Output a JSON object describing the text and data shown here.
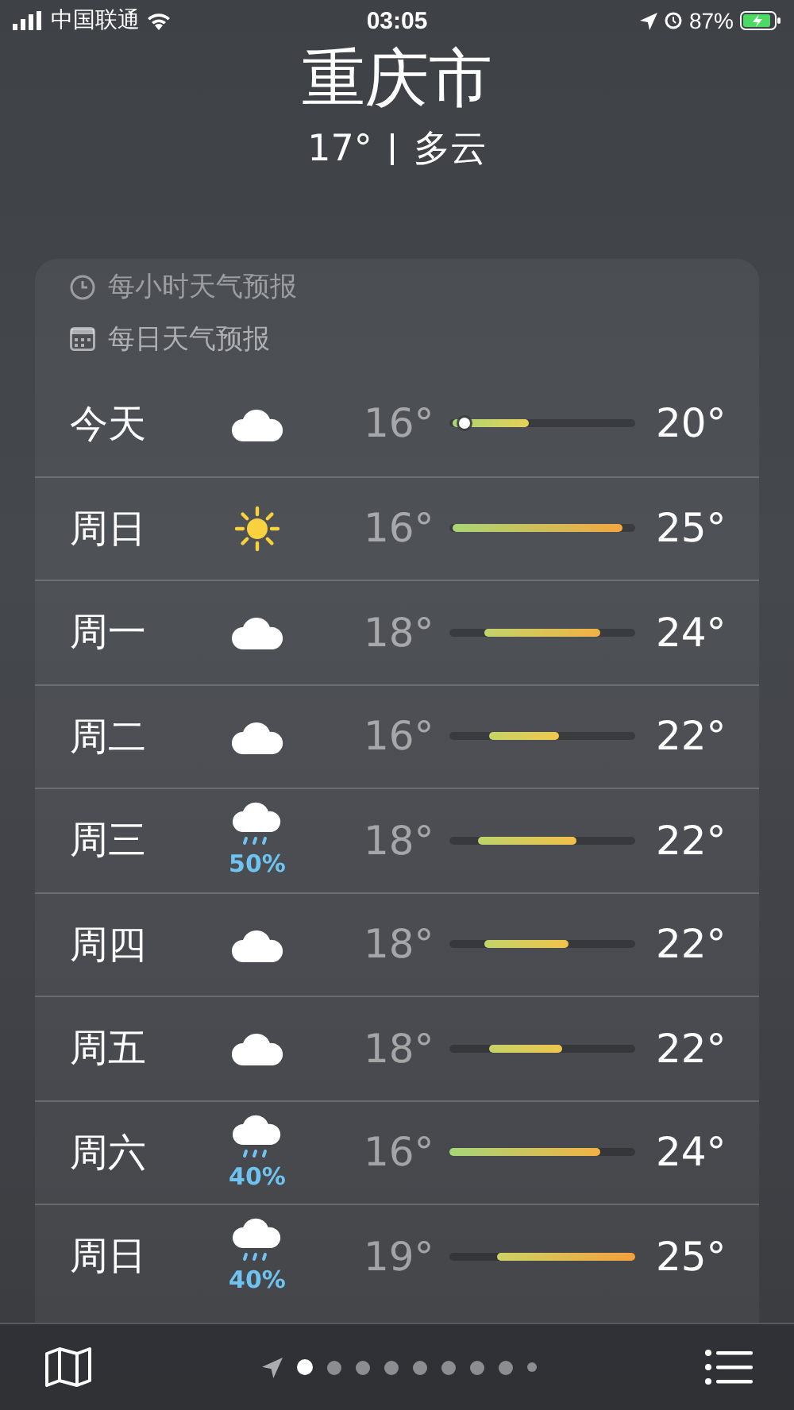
{
  "status_bar": {
    "carrier": "中国联通",
    "time": "03:05",
    "battery": "87%"
  },
  "header": {
    "city": "重庆市",
    "temperature": "17°",
    "condition": "多云"
  },
  "sections": [
    {
      "kind": "hourly",
      "label": "每小时天气预报"
    },
    {
      "kind": "daily",
      "label": "每日天气预报"
    }
  ],
  "days": [
    {
      "day": "今天",
      "kind": "cloud",
      "low": "16°",
      "high": "20°",
      "now_marker": {
        "level": 0.08
      }
    },
    {
      "day": "周日",
      "kind": "sun",
      "low": "16°",
      "high": "25°"
    },
    {
      "day": "周一",
      "kind": "cloud",
      "low": "18°",
      "high": "24°"
    },
    {
      "day": "周二",
      "kind": "cloud",
      "low": "16°",
      "high": "22°"
    },
    {
      "day": "周三",
      "kind": "rain",
      "chance": "50%",
      "low": "18°",
      "high": "22°"
    },
    {
      "day": "周四",
      "kind": "cloud",
      "low": "18°",
      "high": "22°"
    },
    {
      "day": "周五",
      "kind": "cloud",
      "low": "18°",
      "high": "22°"
    },
    {
      "day": "周六",
      "kind": "rain",
      "chance": "40%",
      "low": "16°",
      "high": "24°"
    },
    {
      "day": "周日",
      "kind": "rain",
      "chance": "40%",
      "low": "19°",
      "high": "25°"
    }
  ],
  "pages": [
    {
      "selected": true
    },
    {
      "selected": false
    },
    {
      "selected": false
    },
    {
      "selected": false
    },
    {
      "selected": false
    },
    {
      "selected": false
    },
    {
      "selected": false
    },
    {
      "selected": false
    },
    {
      "selected": false
    }
  ]
}
